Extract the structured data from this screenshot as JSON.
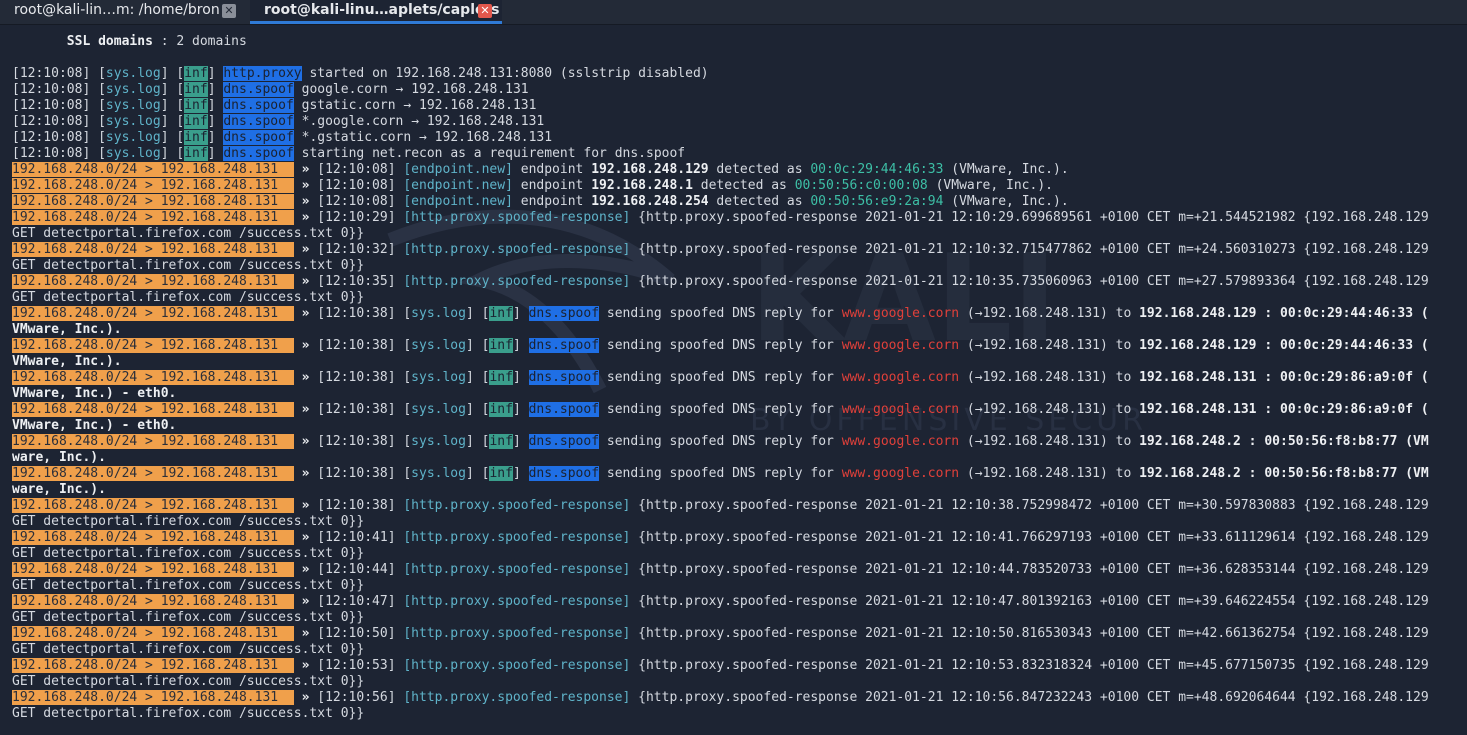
{
  "tabs": [
    {
      "label": "root@kali-lin…m: /home/bron",
      "close": "✕"
    },
    {
      "label": "root@kali-linu…aplets/caplets",
      "close": "✕"
    }
  ],
  "header": {
    "key": "SSL domains",
    "rest": " : 2 domains"
  },
  "boot_lines": [
    {
      "ts": "[12:10:08] ",
      "src": "[sys.log]",
      "lvl": "inf",
      "mod": "http.proxy",
      "msg": " started on 192.168.248.131:8080 (sslstrip disabled)"
    },
    {
      "ts": "[12:10:08] ",
      "src": "[sys.log]",
      "lvl": "inf",
      "mod": "dns.spoof",
      "msg": " google.corn → 192.168.248.131"
    },
    {
      "ts": "[12:10:08] ",
      "src": "[sys.log]",
      "lvl": "inf",
      "mod": "dns.spoof",
      "msg": " gstatic.corn → 192.168.248.131"
    },
    {
      "ts": "[12:10:08] ",
      "src": "[sys.log]",
      "lvl": "inf",
      "mod": "dns.spoof",
      "msg": " *.google.corn → 192.168.248.131"
    },
    {
      "ts": "[12:10:08] ",
      "src": "[sys.log]",
      "lvl": "inf",
      "mod": "dns.spoof",
      "msg": " *.gstatic.corn → 192.168.248.131"
    },
    {
      "ts": "[12:10:08] ",
      "src": "[sys.log]",
      "lvl": "inf",
      "mod": "dns.spoof",
      "msg": " starting net.recon as a requirement for dns.spoof"
    }
  ],
  "prompt_prefix": "192.168.248.0/24 > 192.168.248.131  ",
  "arrow": " » ",
  "endpoint_lines": [
    {
      "ts": "[12:10:08] ",
      "tag": "[endpoint.new]",
      "pre": " endpoint ",
      "ip": "192.168.248.129",
      "mid": " detected as ",
      "mac": "00:0c:29:44:46:33",
      "vendor": " (VMware, Inc.)."
    },
    {
      "ts": "[12:10:08] ",
      "tag": "[endpoint.new]",
      "pre": " endpoint ",
      "ip": "192.168.248.1",
      "mid": " detected as ",
      "mac": "00:50:56:c0:00:08",
      "vendor": " (VMware, Inc.)."
    },
    {
      "ts": "[12:10:08] ",
      "tag": "[endpoint.new]",
      "pre": " endpoint ",
      "ip": "192.168.248.254",
      "mid": " detected as ",
      "mac": "00:50:56:e9:2a:94",
      "vendor": " (VMware, Inc.)."
    }
  ],
  "proxy_tag": "[http.proxy.spoofed-response]",
  "proxy_wrap": "GET detectportal.firefox.com /success.txt 0}}",
  "proxy_lines_a": [
    {
      "ts": "[12:10:29] ",
      "rest": " {http.proxy.spoofed-response 2021-01-21 12:10:29.699689561 +0100 CET m=+21.544521982 {192.168.248.129"
    },
    {
      "ts": "[12:10:32] ",
      "rest": " {http.proxy.spoofed-response 2021-01-21 12:10:32.715477862 +0100 CET m=+24.560310273 {192.168.248.129"
    },
    {
      "ts": "[12:10:35] ",
      "rest": " {http.proxy.spoofed-response 2021-01-21 12:10:35.735060963 +0100 CET m=+27.579893364 {192.168.248.129"
    }
  ],
  "dns_lines": [
    {
      "ts": "[12:10:38] ",
      "src": "[sys.log]",
      "lvl": "inf",
      "mod": "dns.spoof",
      "pre": " sending spoofed DNS reply for ",
      "host": "www.google.corn",
      "mid": " (→192.168.248.131) to ",
      "target": "192.168.248.129 : 00:0c:29:44:46:33 (",
      "wrap": "VMware, Inc.)."
    },
    {
      "ts": "[12:10:38] ",
      "src": "[sys.log]",
      "lvl": "inf",
      "mod": "dns.spoof",
      "pre": " sending spoofed DNS reply for ",
      "host": "www.google.corn",
      "mid": " (→192.168.248.131) to ",
      "target": "192.168.248.129 : 00:0c:29:44:46:33 (",
      "wrap": "VMware, Inc.)."
    },
    {
      "ts": "[12:10:38] ",
      "src": "[sys.log]",
      "lvl": "inf",
      "mod": "dns.spoof",
      "pre": " sending spoofed DNS reply for ",
      "host": "www.google.corn",
      "mid": " (→192.168.248.131) to ",
      "target": "192.168.248.131 : 00:0c:29:86:a9:0f (",
      "wrap": "VMware, Inc.) - eth0."
    },
    {
      "ts": "[12:10:38] ",
      "src": "[sys.log]",
      "lvl": "inf",
      "mod": "dns.spoof",
      "pre": " sending spoofed DNS reply for ",
      "host": "www.google.corn",
      "mid": " (→192.168.248.131) to ",
      "target": "192.168.248.131 : 00:0c:29:86:a9:0f (",
      "wrap": "VMware, Inc.) - eth0."
    },
    {
      "ts": "[12:10:38] ",
      "src": "[sys.log]",
      "lvl": "inf",
      "mod": "dns.spoof",
      "pre": " sending spoofed DNS reply for ",
      "host": "www.google.corn",
      "mid": " (→192.168.248.131) to ",
      "target": "192.168.248.2 : 00:50:56:f8:b8:77 (VM",
      "wrap": "ware, Inc.)."
    },
    {
      "ts": "[12:10:38] ",
      "src": "[sys.log]",
      "lvl": "inf",
      "mod": "dns.spoof",
      "pre": " sending spoofed DNS reply for ",
      "host": "www.google.corn",
      "mid": " (→192.168.248.131) to ",
      "target": "192.168.248.2 : 00:50:56:f8:b8:77 (VM",
      "wrap": "ware, Inc.)."
    }
  ],
  "proxy_lines_b": [
    {
      "ts": "[12:10:38] ",
      "rest": " {http.proxy.spoofed-response 2021-01-21 12:10:38.752998472 +0100 CET m=+30.597830883 {192.168.248.129"
    },
    {
      "ts": "[12:10:41] ",
      "rest": " {http.proxy.spoofed-response 2021-01-21 12:10:41.766297193 +0100 CET m=+33.611129614 {192.168.248.129"
    },
    {
      "ts": "[12:10:44] ",
      "rest": " {http.proxy.spoofed-response 2021-01-21 12:10:44.783520733 +0100 CET m=+36.628353144 {192.168.248.129"
    },
    {
      "ts": "[12:10:47] ",
      "rest": " {http.proxy.spoofed-response 2021-01-21 12:10:47.801392163 +0100 CET m=+39.646224554 {192.168.248.129"
    },
    {
      "ts": "[12:10:50] ",
      "rest": " {http.proxy.spoofed-response 2021-01-21 12:10:50.816530343 +0100 CET m=+42.661362754 {192.168.248.129"
    },
    {
      "ts": "[12:10:53] ",
      "rest": " {http.proxy.spoofed-response 2021-01-21 12:10:53.832318324 +0100 CET m=+45.677150735 {192.168.248.129"
    },
    {
      "ts": "[12:10:56] ",
      "rest": " {http.proxy.spoofed-response 2021-01-21 12:10:56.847232243 +0100 CET m=+48.692064644 {192.168.248.129"
    }
  ],
  "watermark": {
    "logo": "KALI",
    "tagline": "BY OFFENSIVE SECURITY"
  },
  "colors": {
    "background": "#1d2433",
    "inf": "#3a9e8c",
    "module": "#1f6fe5",
    "prefix": "#f0a04b",
    "tag": "#5fb3c9",
    "mac": "#3dbfa6",
    "host": "#e0403a",
    "active_tab_accent": "#2f7ad6"
  }
}
